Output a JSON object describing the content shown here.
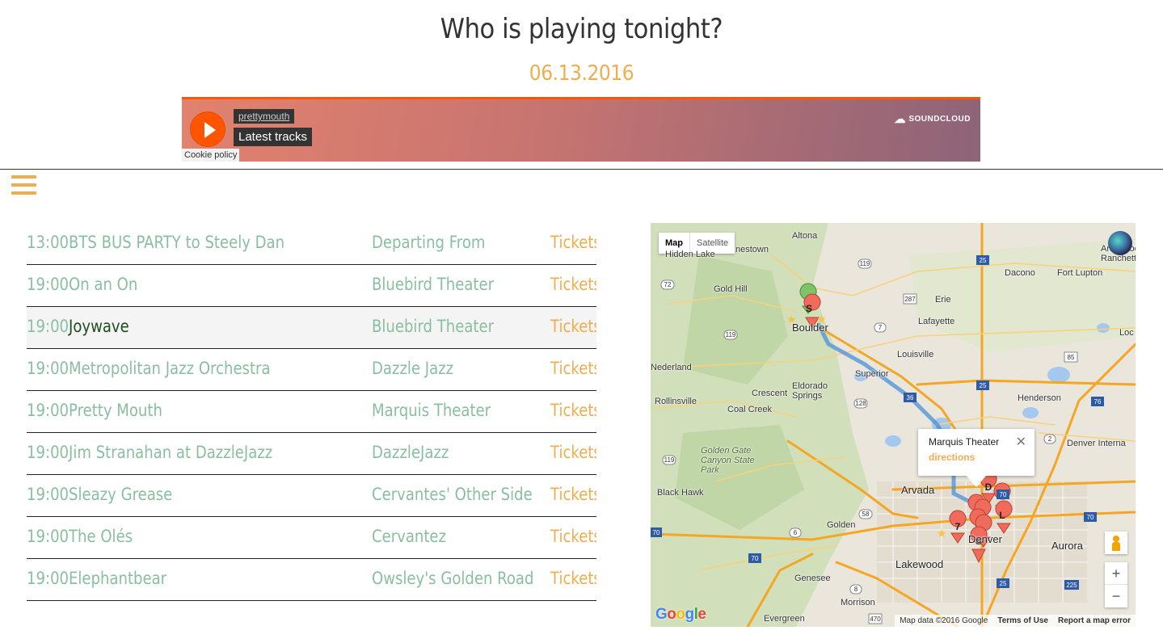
{
  "header": {
    "title": "Who is playing tonight?",
    "date": "06.13.2016"
  },
  "player": {
    "user": "prettymouth",
    "track": "Latest tracks",
    "brand": "SOUNDCLOUD",
    "cookie_policy": "Cookie policy"
  },
  "events": [
    {
      "time": "13:00",
      "name": "BTS BUS PARTY to Steely Dan",
      "venue": "Departing From",
      "tickets": "Tickets"
    },
    {
      "time": "19:00",
      "name": "On an On",
      "venue": "Bluebird Theater",
      "tickets": "Tickets"
    },
    {
      "time": "19:00",
      "name": "Joywave",
      "venue": "Bluebird Theater",
      "tickets": "Tickets",
      "highlight": true
    },
    {
      "time": "19:00",
      "name": "Metropolitan Jazz Orchestra",
      "venue": "Dazzle Jazz",
      "tickets": "Tickets"
    },
    {
      "time": "19:00",
      "name": "Pretty Mouth",
      "venue": "Marquis Theater",
      "tickets": "Tickets"
    },
    {
      "time": "19:00",
      "name": "Jim Stranahan at DazzleJazz",
      "venue": "DazzleJazz",
      "tickets": "Tickets"
    },
    {
      "time": "19:00",
      "name": "Sleazy Grease",
      "venue": "Cervantes' Other Side",
      "tickets": "Tickets"
    },
    {
      "time": "19:00",
      "name": "The Olés",
      "venue": "Cervantez",
      "tickets": "Tickets"
    },
    {
      "time": "19:00",
      "name": "Elephantbear",
      "venue": "Owsley's Golden Road",
      "tickets": "Tickets"
    }
  ],
  "map": {
    "type_map": "Map",
    "type_satellite": "Satellite",
    "info_title": "Marquis Theater",
    "info_link": "directions",
    "zoom_in": "+",
    "zoom_out": "−",
    "google": "Google",
    "attribution": "Map data ©2016 Google",
    "terms": "Terms of Use",
    "report": "Report a map error",
    "places": [
      "Altona",
      "nestown",
      "Hidden Lake",
      "Gold Hill",
      "Boulder",
      "Lafayette",
      "Louisville",
      "Superior",
      "Nederland",
      "Eldorado Springs",
      "Crescent",
      "Rollinsville",
      "Coal Creek",
      "Golden Gate Canyon State Park",
      "Black Hawk",
      "Arvada",
      "Golden",
      "Lakewood",
      "Genesee",
      "Morrison",
      "Evergreen",
      "Denver",
      "Aurora",
      "Henderson",
      "Dacono",
      "Fort Lupton",
      "Erie",
      "Denver Interna",
      "Arapahoe Ranchettes",
      "Loc"
    ],
    "colors": {
      "marker": "#f06b5c",
      "route": "#4a90d9",
      "highway": "#f5a623"
    }
  }
}
